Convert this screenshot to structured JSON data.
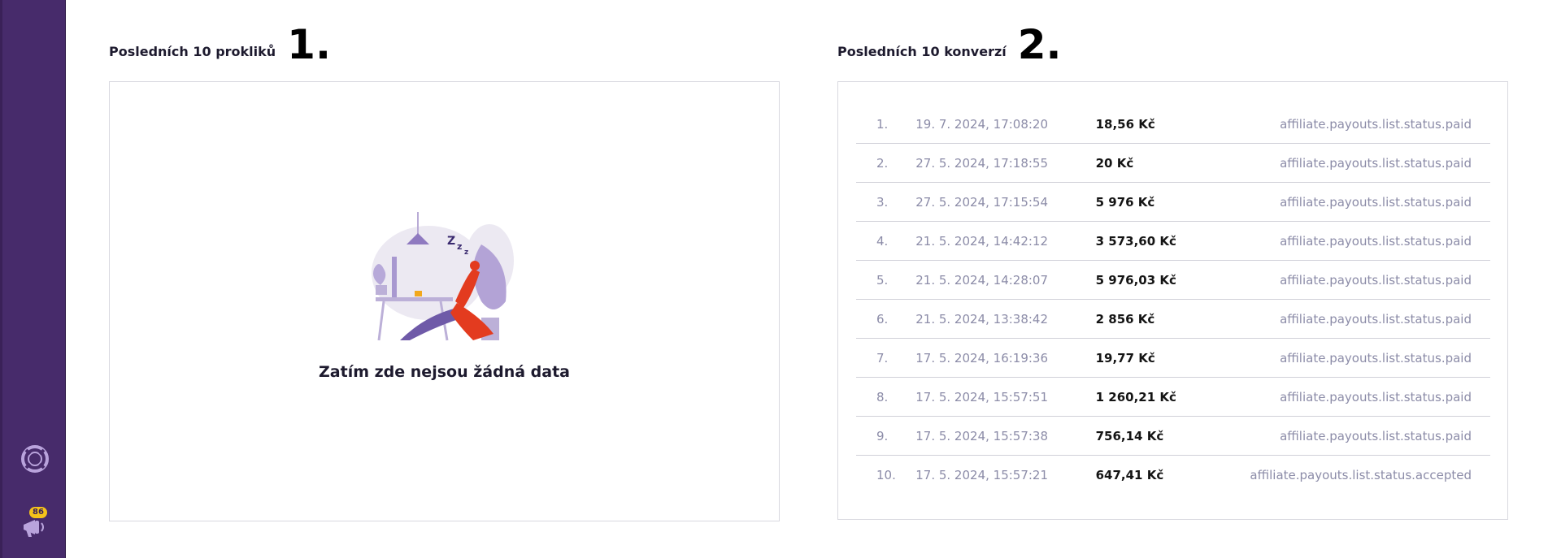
{
  "sidebar": {
    "icons": [
      "lifebuoy-icon",
      "megaphone-icon"
    ],
    "notification_count": "86",
    "color": "#472b6b"
  },
  "clicks": {
    "title": "Posledních 10 prokliků",
    "number": "1.",
    "empty_message": "Zatím zde nejsou žádná data"
  },
  "conversions": {
    "title": "Posledních 10 konverzí",
    "number": "2.",
    "rows": [
      {
        "index": "1.",
        "date": "19. 7. 2024, 17:08:20",
        "amount": "18,56 Kč",
        "status": "affiliate.payouts.list.status.paid"
      },
      {
        "index": "2.",
        "date": "27. 5. 2024, 17:18:55",
        "amount": "20 Kč",
        "status": "affiliate.payouts.list.status.paid"
      },
      {
        "index": "3.",
        "date": "27. 5. 2024, 17:15:54",
        "amount": "5 976 Kč",
        "status": "affiliate.payouts.list.status.paid"
      },
      {
        "index": "4.",
        "date": "21. 5. 2024, 14:42:12",
        "amount": "3 573,60 Kč",
        "status": "affiliate.payouts.list.status.paid"
      },
      {
        "index": "5.",
        "date": "21. 5. 2024, 14:28:07",
        "amount": "5 976,03 Kč",
        "status": "affiliate.payouts.list.status.paid"
      },
      {
        "index": "6.",
        "date": "21. 5. 2024, 13:38:42",
        "amount": "2 856 Kč",
        "status": "affiliate.payouts.list.status.paid"
      },
      {
        "index": "7.",
        "date": "17. 5. 2024, 16:19:36",
        "amount": "19,77 Kč",
        "status": "affiliate.payouts.list.status.paid"
      },
      {
        "index": "8.",
        "date": "17. 5. 2024, 15:57:51",
        "amount": "1 260,21 Kč",
        "status": "affiliate.payouts.list.status.paid"
      },
      {
        "index": "9.",
        "date": "17. 5. 2024, 15:57:38",
        "amount": "756,14 Kč",
        "status": "affiliate.payouts.list.status.paid"
      },
      {
        "index": "10.",
        "date": "17. 5. 2024, 15:57:21",
        "amount": "647,41 Kč",
        "status": "affiliate.payouts.list.status.accepted"
      }
    ]
  }
}
